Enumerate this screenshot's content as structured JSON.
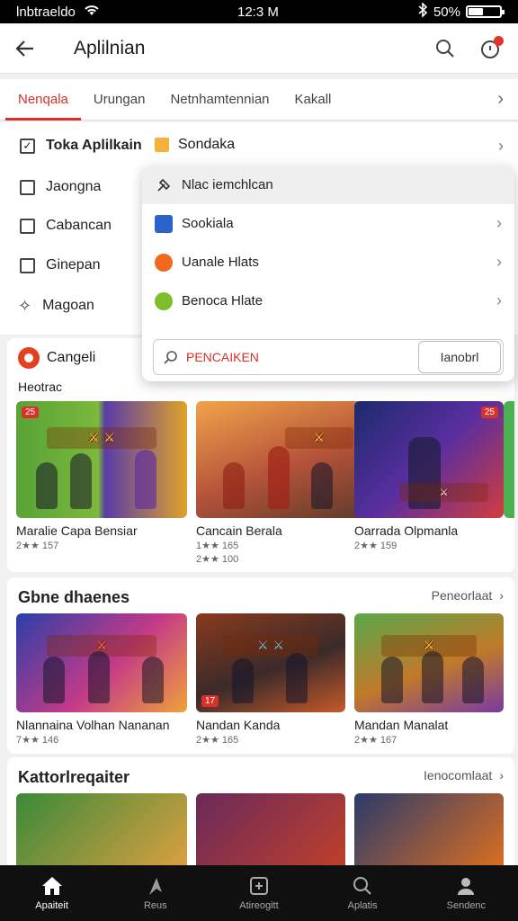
{
  "status": {
    "carrier": "lnbtraeldo",
    "time": "12:3 M",
    "battery": "50%",
    "battery_level": 0.5
  },
  "header": {
    "title": "Aplilnian"
  },
  "tabs": [
    {
      "label": "Nenqala",
      "active": true
    },
    {
      "label": "Urungan"
    },
    {
      "label": "Netnhamtennian"
    },
    {
      "label": "Kakall"
    }
  ],
  "categories": {
    "main": "Toka Aplilkain",
    "sub": "Sondaka",
    "items": [
      "Jaongna",
      "Cabancan",
      "Ginepan",
      "Magoan"
    ]
  },
  "dropdown": {
    "items": [
      {
        "label": "Nlac iemchlcan"
      },
      {
        "label": "Sookiala"
      },
      {
        "label": "Uanale Hlats"
      },
      {
        "label": "Benoca Hlate"
      }
    ],
    "search_placeholder": "PENCAIKEN",
    "button": "Ianobrl"
  },
  "section1": {
    "title": "Cangeli",
    "subtitle": "Heotrac",
    "apps": [
      {
        "name": "Maralie Capa Bensiar",
        "rating": "2★★ 157",
        "badge": "25"
      },
      {
        "name": "Cancain Berala",
        "rating": "1★★ 165",
        "rating2": "2★★ 100"
      },
      {
        "name": "Oarrada Olpmanla",
        "rating": "2★★ 159",
        "badge": "25"
      }
    ]
  },
  "section2": {
    "title": "Gbne dhaenes",
    "more": "Peneorlaat",
    "apps": [
      {
        "name": "Nlannaina Volhan Nananan",
        "rating": "7★★ 146"
      },
      {
        "name": "Nandan Kanda",
        "rating": "2★★ 165",
        "badge": "17"
      },
      {
        "name": "Mandan Manalat",
        "rating": "2★★ 167"
      }
    ]
  },
  "section3": {
    "title": "Kattorlreqaiter",
    "more": "Ienocomlaat"
  },
  "bottom_nav": [
    {
      "label": "Apaiteit",
      "icon": "home-icon",
      "active": true
    },
    {
      "label": "Reus",
      "icon": "flag-icon"
    },
    {
      "label": "Atireogitt",
      "icon": "square-icon"
    },
    {
      "label": "Aplatis",
      "icon": "search-icon"
    },
    {
      "label": "Sendenc",
      "icon": "person-icon"
    }
  ],
  "colors": {
    "accent": "#d9312a",
    "nav_bg": "#101010"
  }
}
